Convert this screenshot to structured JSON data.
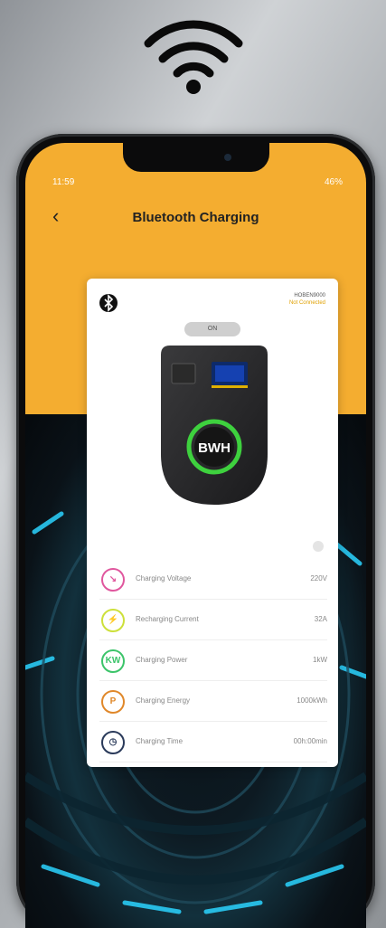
{
  "status_bar": {
    "time": "11:59",
    "right": "46% "
  },
  "header": {
    "back_icon": "chevron-left-icon",
    "title": "Bluetooth Charging"
  },
  "device": {
    "id": "HOBEN9000",
    "connection_status": "Not Connected",
    "button_label": "ON",
    "display_label": "BWH"
  },
  "metrics": [
    {
      "icon": "voltage-gauge-icon",
      "label": "Charging Voltage",
      "value": "220V",
      "color": "#e0579e",
      "glyph": "↘"
    },
    {
      "icon": "current-icon",
      "label": "Recharging Current",
      "value": "32A",
      "color": "#cde03a",
      "glyph": "⚡"
    },
    {
      "icon": "power-icon",
      "label": "Charging Power",
      "value": "1kW",
      "color": "#3cc46a",
      "glyph": "KW"
    },
    {
      "icon": "energy-icon",
      "label": "Charging Energy",
      "value": "1000kWh",
      "color": "#e0882a",
      "glyph": "P"
    },
    {
      "icon": "clock-icon",
      "label": "Charging Time",
      "value": "00h:00min",
      "color": "#2a3a5a",
      "glyph": "◷"
    }
  ],
  "colors": {
    "header": "#f4ad30",
    "ring": "#3ed13e"
  }
}
